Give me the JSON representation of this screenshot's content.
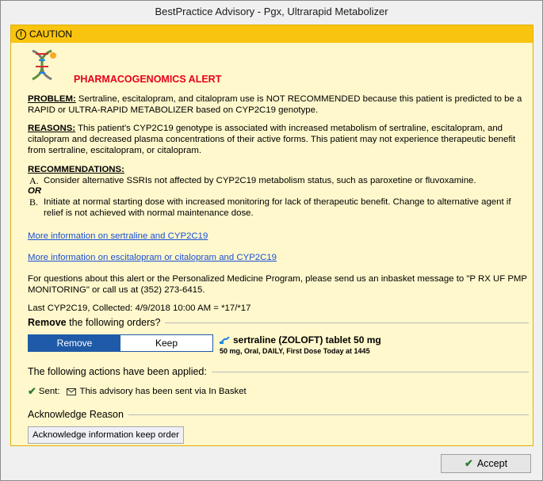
{
  "window": {
    "title": "BestPractice Advisory - Pgx, Ultrarapid Metabolizer"
  },
  "header": {
    "caution_label": "CAUTION",
    "caution_icon": "exclamation-circle-icon"
  },
  "alert": {
    "icon": "dna-icon",
    "title": "PHARMACOGENOMICS ALERT",
    "title_color": "#e8001c"
  },
  "problem": {
    "label": "PROBLEM:",
    "text": " Sertraline, escitalopram, and citalopram use is NOT RECOMMENDED because this patient is predicted to be a RAPID or ULTRA-RAPID METABOLIZER based on CYP2C19 genotype."
  },
  "reasons": {
    "label": "REASONS:",
    "text": " This patient's CYP2C19 genotype is associated with increased metabolism of sertraline, escitalopram, and citalopram and decreased plasma concentrations of their active forms.  This patient may not experience therapeutic benefit from sertraline, escitalopram, or citalopram."
  },
  "recommendations": {
    "label": "RECOMMENDATIONS:",
    "items": [
      {
        "letter": "A.",
        "text": "Consider alternative SSRIs not affected by CYP2C19 metabolism status, such as paroxetine or fluvoxamine."
      },
      {
        "letter": "B.",
        "text": "Initiate at normal starting dose with increased monitoring for lack of therapeutic benefit. Change to alternative agent if relief is not achieved with normal maintenance dose."
      }
    ],
    "or_label": "OR"
  },
  "links": [
    "More information on sertraline and CYP2C19",
    "More information on escitalopram or citalopram and CYP2C19"
  ],
  "contact_text": "For questions about this alert or the Personalized Medicine Program, please send us an inbasket message to \"P RX UF PMP MONITORING\" or call us at (352) 273-6415.",
  "last_result": "Last CYP2C19, Collected: 4/9/2018 10:00 AM = *17/*17",
  "remove_section": {
    "title_bold": "Remove",
    "title_rest": " the following orders?",
    "options": [
      "Remove",
      "Keep"
    ],
    "selected": "Remove",
    "selected_color": "#1f5aa8",
    "medication": {
      "icon": "medication-icon",
      "name": "sertraline (ZOLOFT) tablet 50 mg",
      "sig": "50 mg, Oral, DAILY, First Dose Today at 1445"
    }
  },
  "actions_section": {
    "title": "The following actions have been applied:",
    "sent_label": "Sent:",
    "sent_icon": "envelope-icon",
    "sent_text": "This advisory has been sent via In Basket"
  },
  "acknowledge": {
    "title": "Acknowledge Reason",
    "button_label": "Acknowledge information keep order"
  },
  "footer": {
    "accept_label": "Accept",
    "accept_icon": "checkmark-icon"
  }
}
